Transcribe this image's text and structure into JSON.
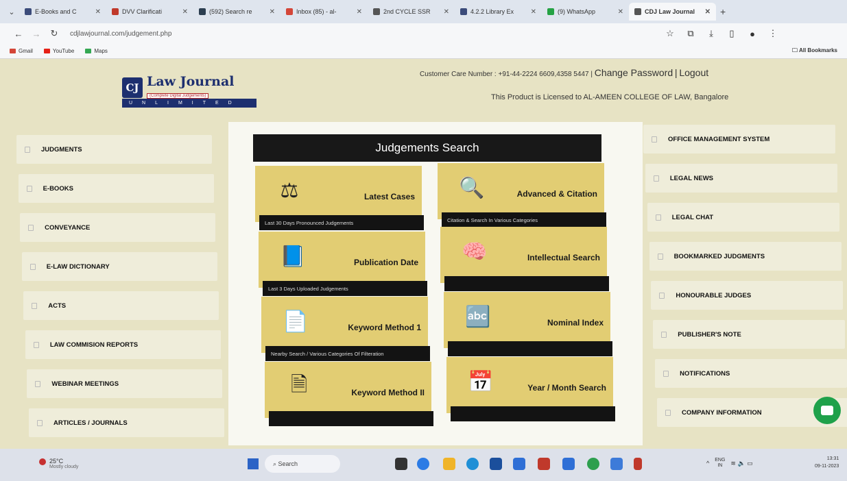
{
  "browser": {
    "tabs": [
      {
        "title": "E-Books and C",
        "color": "#3b4b7a",
        "active": false
      },
      {
        "title": "DVV Clarificati",
        "color": "#c0392b",
        "active": false
      },
      {
        "title": "(592) Search re",
        "color": "#2c3e50",
        "active": false
      },
      {
        "title": "Inbox (85) - al-",
        "color": "#d44638",
        "active": false
      },
      {
        "title": "2nd CYCLE SSR",
        "color": "#555555",
        "active": false
      },
      {
        "title": "4.2.2 Library Ex",
        "color": "#3b4b7a",
        "active": false
      },
      {
        "title": "(9) WhatsApp",
        "color": "#25a244",
        "active": false
      },
      {
        "title": "CDJ Law Journal",
        "color": "#555555",
        "active": true
      }
    ],
    "url": "cdjlawjournal.com/judgement.php",
    "bookmarks": [
      {
        "label": "Gmail",
        "color": "#d44638"
      },
      {
        "label": "YouTube",
        "color": "#e62117"
      },
      {
        "label": "Maps",
        "color": "#34a853"
      }
    ],
    "all_bookmarks": "All Bookmarks"
  },
  "header": {
    "logo_mark": "CJ",
    "logo_name": "Law Journal",
    "logo_sub": "(Complete Digital Judgements)",
    "logo_strip": "UNLIMITED",
    "care_text": "Customer Care Number : +91-44-2224 6609,4358 5447 |",
    "change_password": "Change Password",
    "separator": "|",
    "logout": "Logout",
    "licensed": "This Product is Licensed to AL-AMEEN COLLEGE OF LAW, Bangalore"
  },
  "left_menu": [
    "JUDGMENTS",
    "E-BOOKS",
    "CONVEYANCE",
    "E-LAW DICTIONARY",
    "ACTS",
    "LAW COMMISION REPORTS",
    "WEBINAR MEETINGS",
    "ARTICLES / JOURNALS"
  ],
  "right_menu": [
    "OFFICE MANAGEMENT SYSTEM",
    "LEGAL NEWS",
    "LEGAL CHAT",
    "BOOKMARKED JUDGMENTS",
    "HONOURABLE JUDGES",
    "PUBLISHER'S NOTE",
    "NOTIFICATIONS",
    "COMPANY INFORMATION"
  ],
  "search": {
    "title": "Judgements Search",
    "cards": [
      {
        "title": "Latest Cases",
        "caption": "Last 30 Days Pronounced Judgements",
        "icon": "gavel-icon",
        "glyph": "⚖"
      },
      {
        "title": "Advanced & Citation",
        "caption": "Citation & Search In Various Categories",
        "icon": "zoom-plus-icon",
        "glyph": "🔍"
      },
      {
        "title": "Publication Date",
        "caption": "Last 3 Days Uploaded Judgements",
        "icon": "book-icon",
        "glyph": "📘"
      },
      {
        "title": "Intellectual Search",
        "caption": "",
        "icon": "brain-icon",
        "glyph": "🧠"
      },
      {
        "title": "Keyword Method 1",
        "caption": "Nearby Search / Various Categories Of Filteration",
        "icon": "document-search-icon",
        "glyph": "📄"
      },
      {
        "title": "Nominal Index",
        "caption": "",
        "icon": "abc-icon",
        "glyph": "🔤"
      },
      {
        "title": "Keyword Method II",
        "caption": "",
        "icon": "file-search-icon",
        "glyph": "🗎"
      },
      {
        "title": "Year / Month Search",
        "caption": "",
        "icon": "calendar-icon",
        "glyph": "📅"
      }
    ]
  },
  "taskbar": {
    "temp": "25°C",
    "weather": "Mostly cloudy",
    "search": "Search",
    "lang_top": "ENG",
    "lang_bottom": "IN",
    "time": "13:31",
    "date": "09-11-2023"
  }
}
